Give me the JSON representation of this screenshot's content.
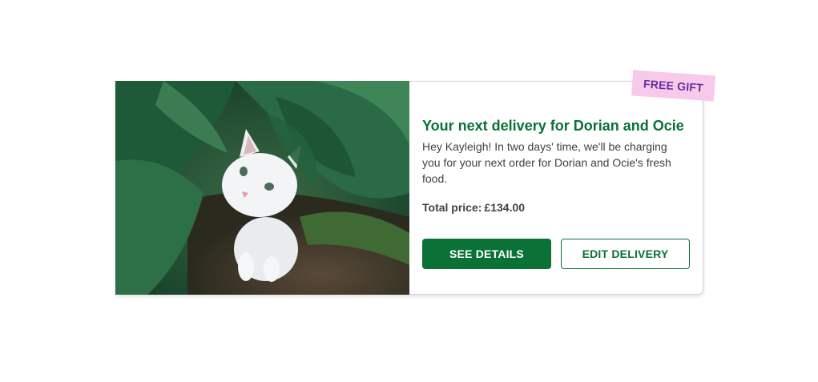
{
  "card": {
    "image_alt_icon": "cat-photo",
    "title": "Your next delivery for Dorian and Ocie",
    "body": "Hey Kayleigh! In two days' time, we'll be charging you for your next order for Dorian and Ocie's fresh food.",
    "price_label": "Total price:",
    "price_value": "£134.00",
    "primary_button": "SEE DETAILS",
    "secondary_button": "EDIT DELIVERY",
    "badge": "FREE GIFT"
  },
  "colors": {
    "brand_green": "#0a7137",
    "badge_bg": "#f7c9ea",
    "badge_text": "#6a2ba0",
    "body_text": "#414141"
  }
}
